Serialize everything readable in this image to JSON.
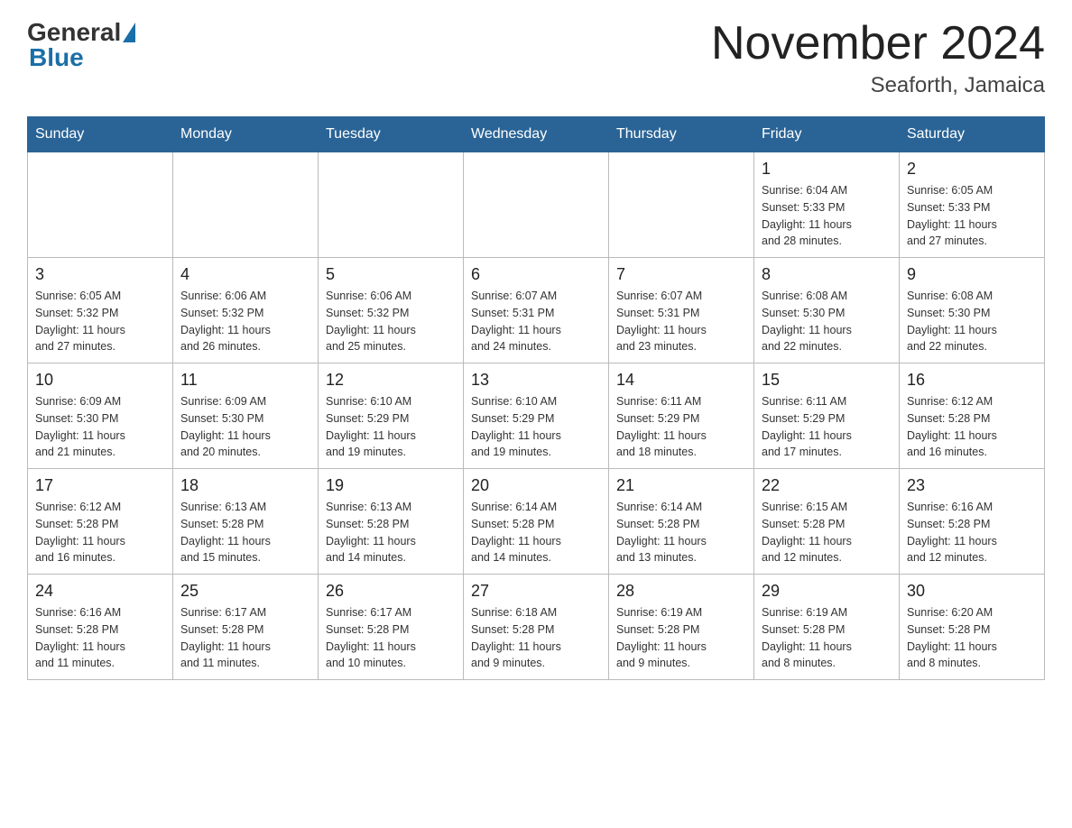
{
  "header": {
    "logo_general": "General",
    "logo_blue": "Blue",
    "month_title": "November 2024",
    "location": "Seaforth, Jamaica"
  },
  "weekdays": [
    "Sunday",
    "Monday",
    "Tuesday",
    "Wednesday",
    "Thursday",
    "Friday",
    "Saturday"
  ],
  "weeks": [
    [
      {
        "day": "",
        "info": ""
      },
      {
        "day": "",
        "info": ""
      },
      {
        "day": "",
        "info": ""
      },
      {
        "day": "",
        "info": ""
      },
      {
        "day": "",
        "info": ""
      },
      {
        "day": "1",
        "info": "Sunrise: 6:04 AM\nSunset: 5:33 PM\nDaylight: 11 hours\nand 28 minutes."
      },
      {
        "day": "2",
        "info": "Sunrise: 6:05 AM\nSunset: 5:33 PM\nDaylight: 11 hours\nand 27 minutes."
      }
    ],
    [
      {
        "day": "3",
        "info": "Sunrise: 6:05 AM\nSunset: 5:32 PM\nDaylight: 11 hours\nand 27 minutes."
      },
      {
        "day": "4",
        "info": "Sunrise: 6:06 AM\nSunset: 5:32 PM\nDaylight: 11 hours\nand 26 minutes."
      },
      {
        "day": "5",
        "info": "Sunrise: 6:06 AM\nSunset: 5:32 PM\nDaylight: 11 hours\nand 25 minutes."
      },
      {
        "day": "6",
        "info": "Sunrise: 6:07 AM\nSunset: 5:31 PM\nDaylight: 11 hours\nand 24 minutes."
      },
      {
        "day": "7",
        "info": "Sunrise: 6:07 AM\nSunset: 5:31 PM\nDaylight: 11 hours\nand 23 minutes."
      },
      {
        "day": "8",
        "info": "Sunrise: 6:08 AM\nSunset: 5:30 PM\nDaylight: 11 hours\nand 22 minutes."
      },
      {
        "day": "9",
        "info": "Sunrise: 6:08 AM\nSunset: 5:30 PM\nDaylight: 11 hours\nand 22 minutes."
      }
    ],
    [
      {
        "day": "10",
        "info": "Sunrise: 6:09 AM\nSunset: 5:30 PM\nDaylight: 11 hours\nand 21 minutes."
      },
      {
        "day": "11",
        "info": "Sunrise: 6:09 AM\nSunset: 5:30 PM\nDaylight: 11 hours\nand 20 minutes."
      },
      {
        "day": "12",
        "info": "Sunrise: 6:10 AM\nSunset: 5:29 PM\nDaylight: 11 hours\nand 19 minutes."
      },
      {
        "day": "13",
        "info": "Sunrise: 6:10 AM\nSunset: 5:29 PM\nDaylight: 11 hours\nand 19 minutes."
      },
      {
        "day": "14",
        "info": "Sunrise: 6:11 AM\nSunset: 5:29 PM\nDaylight: 11 hours\nand 18 minutes."
      },
      {
        "day": "15",
        "info": "Sunrise: 6:11 AM\nSunset: 5:29 PM\nDaylight: 11 hours\nand 17 minutes."
      },
      {
        "day": "16",
        "info": "Sunrise: 6:12 AM\nSunset: 5:28 PM\nDaylight: 11 hours\nand 16 minutes."
      }
    ],
    [
      {
        "day": "17",
        "info": "Sunrise: 6:12 AM\nSunset: 5:28 PM\nDaylight: 11 hours\nand 16 minutes."
      },
      {
        "day": "18",
        "info": "Sunrise: 6:13 AM\nSunset: 5:28 PM\nDaylight: 11 hours\nand 15 minutes."
      },
      {
        "day": "19",
        "info": "Sunrise: 6:13 AM\nSunset: 5:28 PM\nDaylight: 11 hours\nand 14 minutes."
      },
      {
        "day": "20",
        "info": "Sunrise: 6:14 AM\nSunset: 5:28 PM\nDaylight: 11 hours\nand 14 minutes."
      },
      {
        "day": "21",
        "info": "Sunrise: 6:14 AM\nSunset: 5:28 PM\nDaylight: 11 hours\nand 13 minutes."
      },
      {
        "day": "22",
        "info": "Sunrise: 6:15 AM\nSunset: 5:28 PM\nDaylight: 11 hours\nand 12 minutes."
      },
      {
        "day": "23",
        "info": "Sunrise: 6:16 AM\nSunset: 5:28 PM\nDaylight: 11 hours\nand 12 minutes."
      }
    ],
    [
      {
        "day": "24",
        "info": "Sunrise: 6:16 AM\nSunset: 5:28 PM\nDaylight: 11 hours\nand 11 minutes."
      },
      {
        "day": "25",
        "info": "Sunrise: 6:17 AM\nSunset: 5:28 PM\nDaylight: 11 hours\nand 11 minutes."
      },
      {
        "day": "26",
        "info": "Sunrise: 6:17 AM\nSunset: 5:28 PM\nDaylight: 11 hours\nand 10 minutes."
      },
      {
        "day": "27",
        "info": "Sunrise: 6:18 AM\nSunset: 5:28 PM\nDaylight: 11 hours\nand 9 minutes."
      },
      {
        "day": "28",
        "info": "Sunrise: 6:19 AM\nSunset: 5:28 PM\nDaylight: 11 hours\nand 9 minutes."
      },
      {
        "day": "29",
        "info": "Sunrise: 6:19 AM\nSunset: 5:28 PM\nDaylight: 11 hours\nand 8 minutes."
      },
      {
        "day": "30",
        "info": "Sunrise: 6:20 AM\nSunset: 5:28 PM\nDaylight: 11 hours\nand 8 minutes."
      }
    ]
  ]
}
